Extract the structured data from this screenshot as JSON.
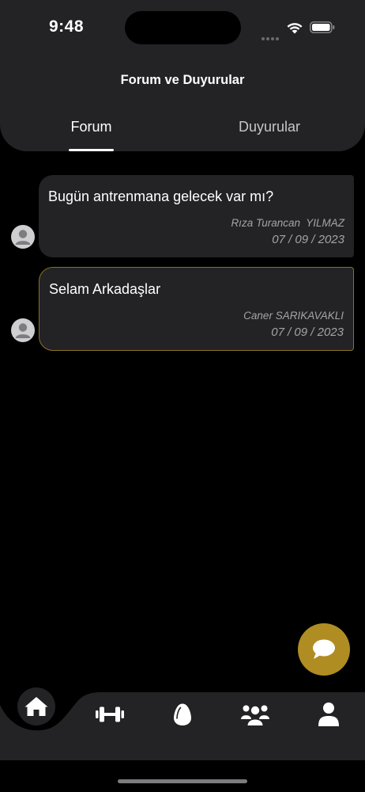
{
  "status_bar": {
    "time": "9:48",
    "icons": [
      "signal-dots-icon",
      "wifi-icon",
      "battery-icon"
    ]
  },
  "header": {
    "title": "Forum ve Duyurular",
    "tabs": [
      {
        "label": "Forum",
        "active": true
      },
      {
        "label": "Duyurular",
        "active": false
      }
    ]
  },
  "posts": [
    {
      "text": "Bugün antrenmana gelecek var mı?",
      "author": "Rıza Turancan  YILMAZ",
      "date": "07 / 09 / 2023",
      "highlighted": false
    },
    {
      "text": "Selam Arkadaşlar",
      "author": "Caner SARIKAVAKLI",
      "date": "07 / 09 / 2023",
      "highlighted": true
    }
  ],
  "fab": {
    "icon": "chat-bubble-icon",
    "color": "#b08d23"
  },
  "bottom_nav": {
    "items": [
      {
        "icon": "home-icon",
        "active": true
      },
      {
        "icon": "dumbbell-icon",
        "active": false
      },
      {
        "icon": "egg-icon",
        "active": false
      },
      {
        "icon": "users-icon",
        "active": false
      },
      {
        "icon": "profile-icon",
        "active": false
      }
    ]
  },
  "colors": {
    "background": "#000000",
    "surface": "#232225",
    "accent": "#b08d23",
    "muted_text": "#a4a4a7"
  }
}
